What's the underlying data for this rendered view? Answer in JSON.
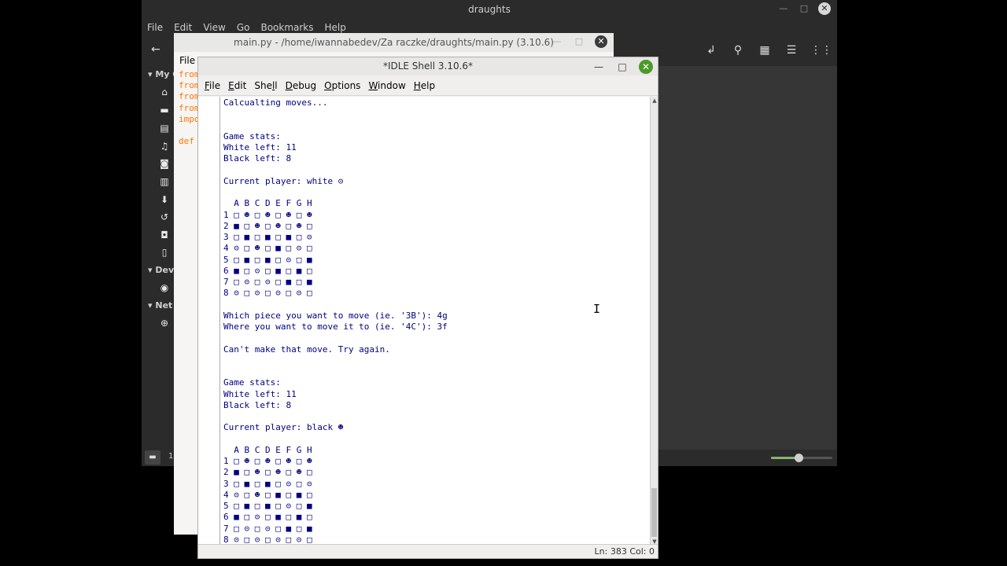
{
  "file_manager": {
    "title": "draughts",
    "menu": [
      "File",
      "Edit",
      "View",
      "Go",
      "Bookmarks",
      "Help"
    ],
    "sidebar": {
      "section_my": "My C",
      "section_devices": "Dev",
      "section_network": "Net"
    },
    "statusbar_label": "1",
    "zoom_fraction": 0.45
  },
  "editor": {
    "title": "main.py - /home/iwannabedev/Za raczke/draughts/main.py (3.10.6)",
    "menu_file": "File",
    "code_lines": [
      "from",
      "from",
      "from",
      "from",
      "impo",
      "",
      "def"
    ]
  },
  "shell": {
    "title": "*IDLE Shell 3.10.6*",
    "menu": [
      {
        "pre": "",
        "u": "F",
        "post": "ile"
      },
      {
        "pre": "",
        "u": "E",
        "post": "dit"
      },
      {
        "pre": "She",
        "u": "l",
        "post": "l"
      },
      {
        "pre": "",
        "u": "D",
        "post": "ebug"
      },
      {
        "pre": "",
        "u": "O",
        "post": "ptions"
      },
      {
        "pre": "",
        "u": "W",
        "post": "indow"
      },
      {
        "pre": "",
        "u": "H",
        "post": "elp"
      }
    ],
    "lines": [
      "Calcualting moves...",
      "",
      "",
      "Game stats:",
      "White left: 11",
      "Black left: 8",
      "",
      "Current player: white ⊝",
      "",
      "  A B C D E F G H",
      "1 □ ☻ □ ☻ □ ☻ □ ☻",
      "2 ■ □ ☻ □ ☻ □ ☻ □",
      "3 □ ■ □ ■ □ ■ □ ⊝",
      "4 ⊝ □ ☻ □ ■ □ ⊝ □",
      "5 □ ■ □ ■ □ ⊝ □ ■",
      "6 ■ □ ⊝ □ ■ □ ■ □",
      "7 □ ⊝ □ ⊝ □ ■ □ ■",
      "8 ⊝ □ ⊝ □ ⊝ □ ⊝ □",
      "",
      "Which piece you want to move (ie. '3B'): 4g",
      "Where you want to move it to (ie. '4C'): 3f",
      "",
      "Can't make that move. Try again.",
      "",
      "",
      "Game stats:",
      "White left: 11",
      "Black left: 8",
      "",
      "Current player: black ☻",
      "",
      "  A B C D E F G H",
      "1 □ ☻ □ ☻ □ ☻ □ ☻",
      "2 ■ □ ☻ □ ☻ □ ☻ □",
      "3 □ ■ □ ■ □ ⊝ □ ⊝",
      "4 ⊝ □ ☻ □ ■ □ ■ □",
      "5 □ ■ □ ■ □ ⊝ □ ■",
      "6 ■ □ ⊝ □ ■ □ ■ □",
      "7 □ ⊝ □ ⊝ □ ■ □ ■",
      "8 ⊝ □ ⊝ □ ⊝ □ ⊝ □"
    ],
    "status": "Ln: 383  Col: 0"
  }
}
